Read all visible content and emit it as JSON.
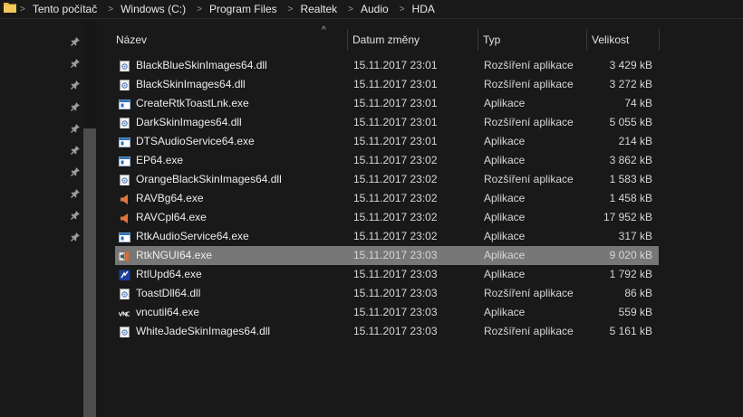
{
  "breadcrumb": {
    "items": [
      "Tento počítač",
      "Windows (C:)",
      "Program Files",
      "Realtek",
      "Audio",
      "HDA"
    ]
  },
  "columns": {
    "name": "Název",
    "date": "Datum změny",
    "type": "Typ",
    "size": "Velikost"
  },
  "colors": {
    "background": "#191919",
    "selected_row": "#777777",
    "folder": "#e8b84a"
  },
  "files": [
    {
      "name": "BlackBlueSkinImages64.dll",
      "date": "15.11.2017 23:01",
      "type": "Rozšíření aplikace",
      "size": "3 429 kB",
      "icon": "dll-icon"
    },
    {
      "name": "BlackSkinImages64.dll",
      "date": "15.11.2017 23:01",
      "type": "Rozšíření aplikace",
      "size": "3 272 kB",
      "icon": "dll-icon"
    },
    {
      "name": "CreateRtkToastLnk.exe",
      "date": "15.11.2017 23:01",
      "type": "Aplikace",
      "size": "74 kB",
      "icon": "exe-window-icon"
    },
    {
      "name": "DarkSkinImages64.dll",
      "date": "15.11.2017 23:01",
      "type": "Rozšíření aplikace",
      "size": "5 055 kB",
      "icon": "dll-icon"
    },
    {
      "name": "DTSAudioService64.exe",
      "date": "15.11.2017 23:01",
      "type": "Aplikace",
      "size": "214 kB",
      "icon": "exe-window-icon"
    },
    {
      "name": "EP64.exe",
      "date": "15.11.2017 23:02",
      "type": "Aplikace",
      "size": "3 862 kB",
      "icon": "exe-window-icon"
    },
    {
      "name": "OrangeBlackSkinImages64.dll",
      "date": "15.11.2017 23:02",
      "type": "Rozšíření aplikace",
      "size": "1 583 kB",
      "icon": "dll-icon"
    },
    {
      "name": "RAVBg64.exe",
      "date": "15.11.2017 23:02",
      "type": "Aplikace",
      "size": "1 458 kB",
      "icon": "speaker-icon"
    },
    {
      "name": "RAVCpl64.exe",
      "date": "15.11.2017 23:02",
      "type": "Aplikace",
      "size": "17 952 kB",
      "icon": "speaker-icon"
    },
    {
      "name": "RtkAudioService64.exe",
      "date": "15.11.2017 23:02",
      "type": "Aplikace",
      "size": "317 kB",
      "icon": "exe-window-icon"
    },
    {
      "name": "RtkNGUI64.exe",
      "date": "15.11.2017 23:03",
      "type": "Aplikace",
      "size": "9 020 kB",
      "icon": "realtek-gui-icon",
      "selected": true
    },
    {
      "name": "RtlUpd64.exe",
      "date": "15.11.2017 23:03",
      "type": "Aplikace",
      "size": "1 792 kB",
      "icon": "updater-icon"
    },
    {
      "name": "ToastDll64.dll",
      "date": "15.11.2017 23:03",
      "type": "Rozšíření aplikace",
      "size": "86 kB",
      "icon": "dll-icon"
    },
    {
      "name": "vncutil64.exe",
      "date": "15.11.2017 23:03",
      "type": "Aplikace",
      "size": "559 kB",
      "icon": "vnc-icon"
    },
    {
      "name": "WhiteJadeSkinImages64.dll",
      "date": "15.11.2017 23:03",
      "type": "Rozšíření aplikace",
      "size": "5 161 kB",
      "icon": "dll-icon"
    }
  ]
}
